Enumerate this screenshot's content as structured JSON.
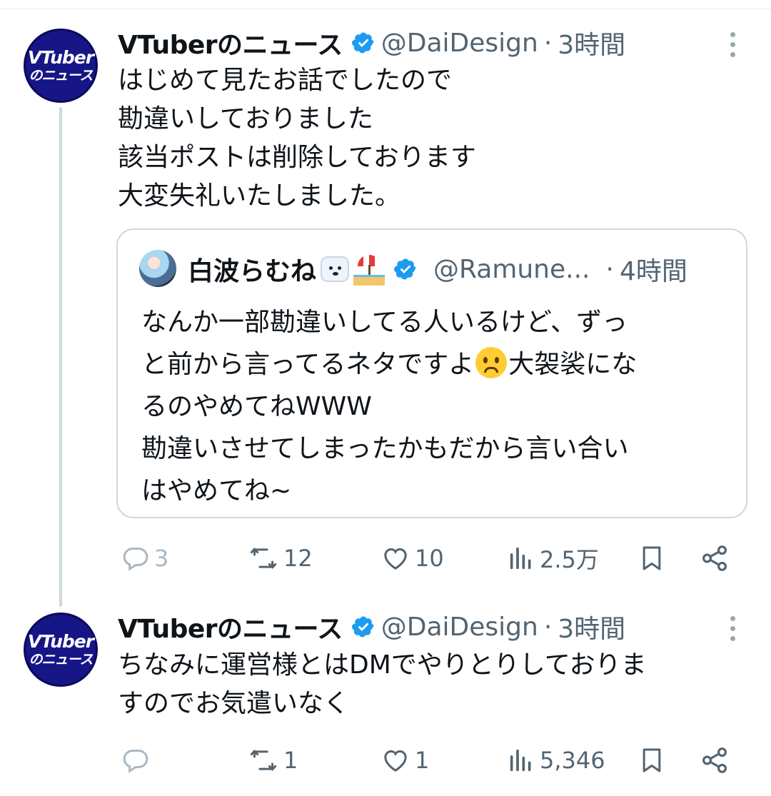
{
  "colors": {
    "accent": "#1d9bf0",
    "avatar_bg": "#161687"
  },
  "posts": [
    {
      "author_name": "VTuberのニュース",
      "avatar_text": [
        "VTuber",
        "のニュース"
      ],
      "handle": "@DaiDesign",
      "separator": "·",
      "time": "3時間",
      "text_lines": [
        "はじめて見たお話でしたので",
        "勘違いしておりました",
        "該当ポストは削除しております",
        "大変失礼いたしました。"
      ],
      "quote": {
        "author_name": "白波らむね",
        "emojis": [
          "polar-bear-emoji",
          "beach-umbrella-emoji"
        ],
        "handle": "@Ramune...",
        "separator": "·",
        "time": "4時間",
        "text_lines": [
          "なんか一部勘違いしてる人いるけど、ずっ",
          [
            "と前から言ってるネタですよ",
            "大袈裟にな"
          ],
          "るのやめてねWWW",
          "勘違いさせてしまったかもだから言い合い",
          "はやめてね~"
        ]
      },
      "stats": {
        "replies": "3",
        "reposts": "12",
        "likes": "10",
        "views": "2.5万"
      }
    },
    {
      "author_name": "VTuberのニュース",
      "avatar_text": [
        "VTuber",
        "のニュース"
      ],
      "handle": "@DaiDesign",
      "separator": "·",
      "time": "3時間",
      "text_lines": [
        "ちなみに運営様とはDMでやりとりしておりま",
        "すのでお気遣いなく"
      ],
      "stats": {
        "replies": "",
        "reposts": "1",
        "likes": "1",
        "views": "5,346"
      }
    }
  ]
}
